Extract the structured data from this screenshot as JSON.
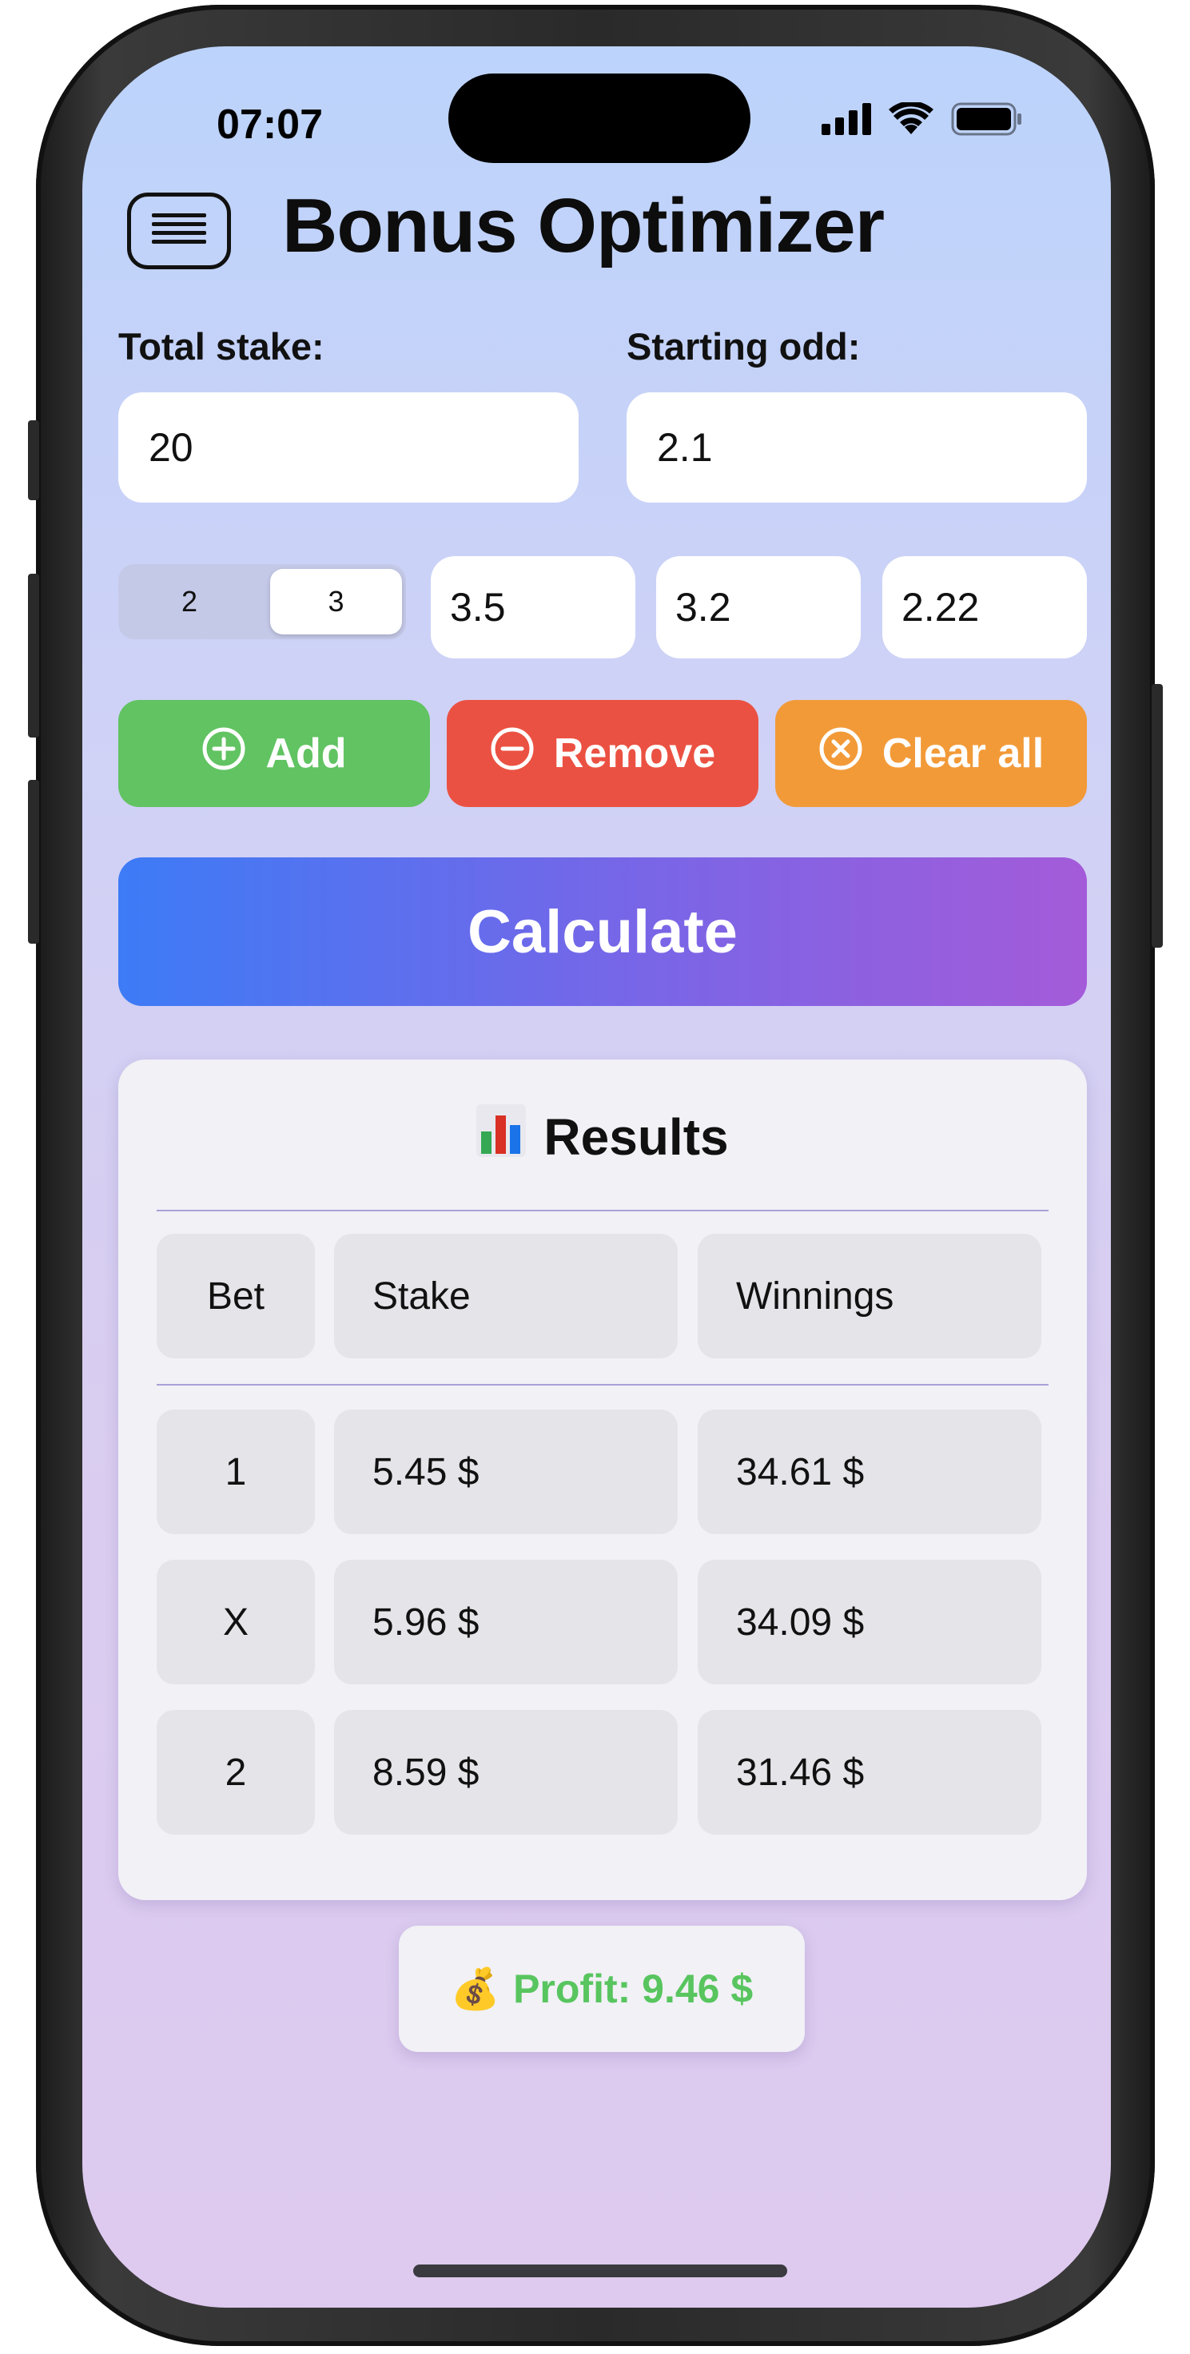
{
  "status_bar": {
    "time": "07:07"
  },
  "header": {
    "title": "Bonus Optimizer"
  },
  "inputs": {
    "total_stake_label": "Total stake:",
    "total_stake_value": "20",
    "starting_odd_label": "Starting odd:",
    "starting_odd_value": "2.1"
  },
  "segmented": {
    "options": [
      "2",
      "3"
    ],
    "selected": "3"
  },
  "odds": [
    "3.5",
    "3.2",
    "2.22"
  ],
  "actions": {
    "add": "Add",
    "remove": "Remove",
    "clear_all": "Clear all"
  },
  "calculate_label": "Calculate",
  "results": {
    "title": "Results",
    "headers": [
      "Bet",
      "Stake",
      "Winnings"
    ],
    "rows": [
      {
        "bet": "1",
        "stake": "5.45 $",
        "winnings": "34.61 $"
      },
      {
        "bet": "X",
        "stake": "5.96 $",
        "winnings": "34.09 $"
      },
      {
        "bet": "2",
        "stake": "8.59 $",
        "winnings": "31.46 $"
      }
    ]
  },
  "profit": {
    "emoji": "💰",
    "text": "Profit: 9.46 $"
  },
  "colors": {
    "add": "#61c362",
    "remove": "#eb5142",
    "clear_all": "#f29a38",
    "profit_text": "#58c55f",
    "calc_gradient_start": "#3d7bf6",
    "calc_gradient_end": "#a45bd9"
  },
  "icons": {
    "menu": "hamburger-icon",
    "add": "plus-circle-icon",
    "remove": "minus-circle-icon",
    "clear_all": "x-circle-icon",
    "results": "bar-chart-icon",
    "profit": "money-bag-icon"
  }
}
